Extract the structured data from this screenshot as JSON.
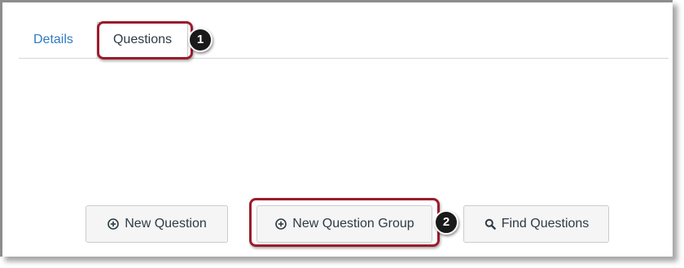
{
  "tabs": {
    "details_label": "Details",
    "questions_label": "Questions"
  },
  "callouts": {
    "step1": "1",
    "step2": "2"
  },
  "actions": {
    "new_question_label": "New Question",
    "new_question_icon": "plus-circle-icon",
    "new_group_label": "New Question Group",
    "new_group_icon": "plus-circle-icon",
    "find_questions_label": "Find Questions",
    "find_questions_icon": "search-icon"
  },
  "colors": {
    "link": "#2d7bc4",
    "highlight": "#9b1c2b",
    "text": "#2d3b45",
    "button_bg": "#f5f5f5"
  }
}
